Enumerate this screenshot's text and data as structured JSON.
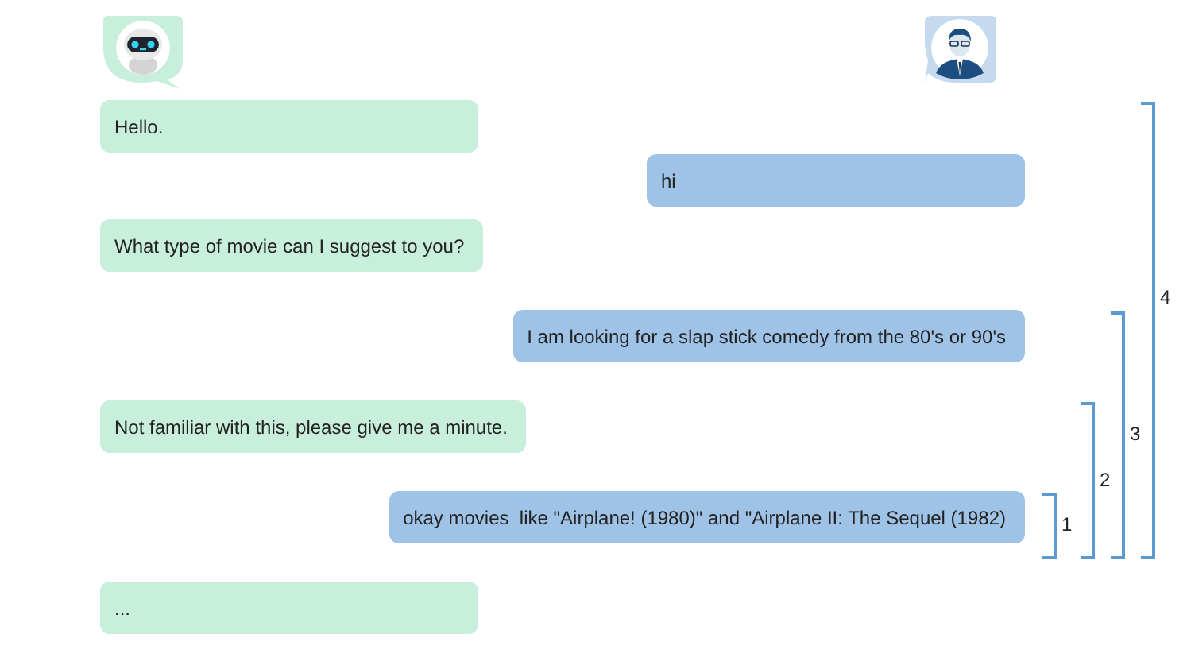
{
  "avatars": [
    {
      "kind": "bot"
    },
    {
      "kind": "user"
    }
  ],
  "messages": [
    {
      "kind": "bot",
      "text": "Hello.",
      "bracket_label": "4"
    },
    {
      "kind": "user",
      "text": "hi"
    },
    {
      "kind": "bot",
      "text": "What type of movie can I suggest to you?"
    },
    {
      "kind": "user",
      "text": "I am looking for a slap stick comedy from the 80's or 90's",
      "bracket_label": "3"
    },
    {
      "kind": "bot",
      "text": "Not familiar with this, please give me a minute.",
      "bracket_label": "2"
    },
    {
      "kind": "user",
      "text": "okay movies  like \"Airplane! (1980)\" and \"Airplane II: The Sequel (1982)",
      "bracket_label": "1"
    },
    {
      "kind": "bot",
      "text": "..."
    }
  ]
}
